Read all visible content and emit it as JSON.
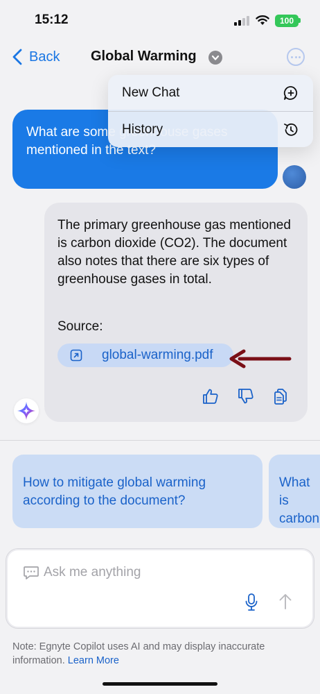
{
  "status_bar": {
    "time": "15:12",
    "battery": "100"
  },
  "nav": {
    "back_label": "Back",
    "title": "Global Warming",
    "menu": {
      "new_chat": "New Chat",
      "history": "History"
    }
  },
  "conversation": {
    "user_message": "What are some greenhouse gases mentioned in the text?",
    "bot_message": "The primary greenhouse gas mentioned is carbon dioxide (CO2). The document also notes that there are six types of greenhouse gases in total.",
    "source_label": "Source:",
    "source_file": "global-warming.pdf"
  },
  "suggestions": [
    "How to mitigate global warming according to the document?",
    "What is carbon"
  ],
  "composer": {
    "placeholder": "Ask me anything"
  },
  "footer": {
    "note": "Note: Egnyte Copilot uses AI and may display inaccurate information.",
    "link": "Learn More"
  },
  "colors": {
    "accent": "#1a7ae6",
    "annotation_arrow": "#7a0f17"
  },
  "icons": [
    "back-chevron-icon",
    "chevron-down-icon",
    "more-icon",
    "new-chat-icon",
    "history-icon",
    "open-external-icon",
    "thumbs-up-icon",
    "thumbs-down-icon",
    "copy-icon",
    "copilot-sparkle-icon",
    "chat-bubble-icon",
    "microphone-icon",
    "send-arrow-icon"
  ]
}
